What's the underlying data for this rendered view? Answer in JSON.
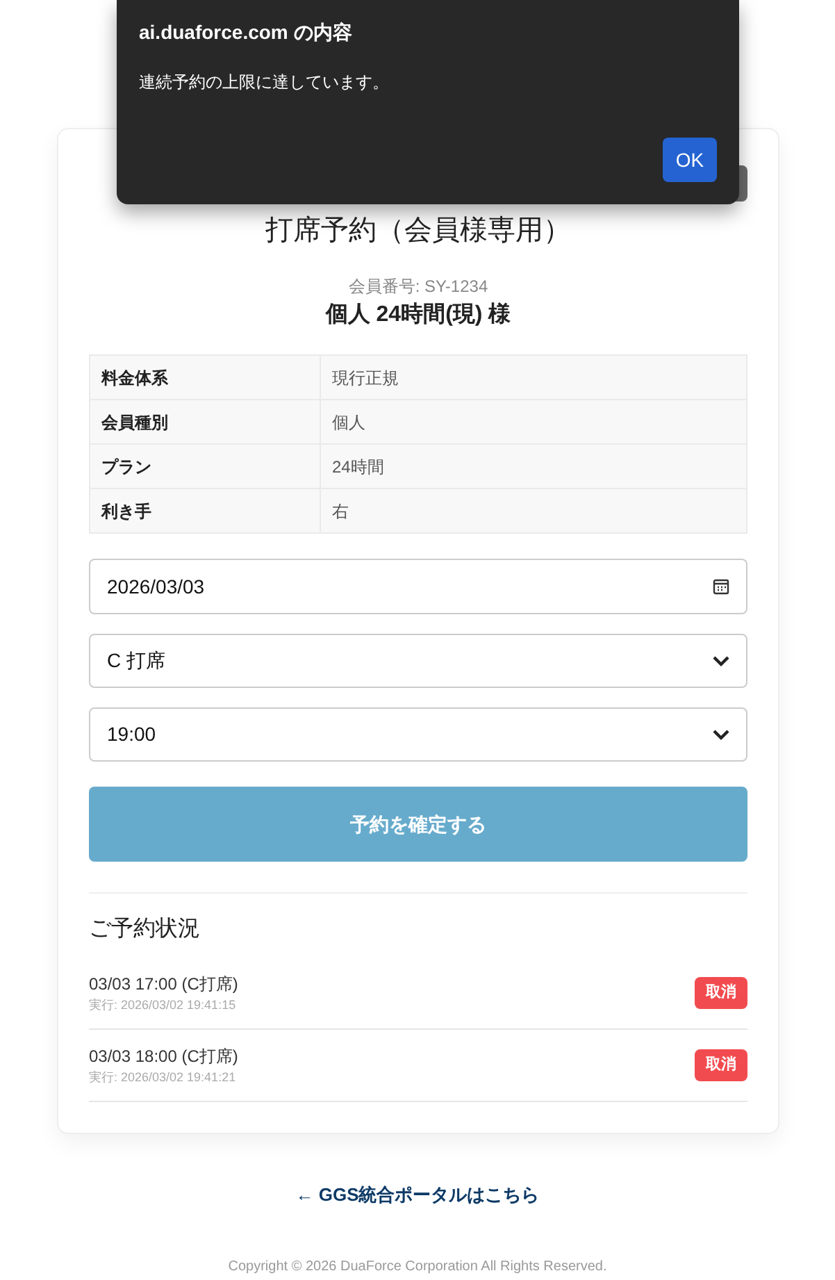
{
  "dialog": {
    "title": "ai.duaforce.com の内容",
    "message": "連続予約の上限に達しています。",
    "ok_button": "OK"
  },
  "page": {
    "title": "打席予約（会員様専用）",
    "member_number": "会員番号: SY-1234",
    "member_name": "個人 24時間(現) 様"
  },
  "member_info": [
    {
      "label": "料金体系",
      "value": "現行正規"
    },
    {
      "label": "会員種別",
      "value": "個人"
    },
    {
      "label": "プラン",
      "value": "24時間"
    },
    {
      "label": "利き手",
      "value": "右"
    }
  ],
  "form": {
    "date": "2026/03/03",
    "bay": "C 打席",
    "time": "19:00",
    "submit_button": "予約を確定する"
  },
  "reservations": {
    "title": "ご予約状況",
    "items": [
      {
        "slot": "03/03 17:00 (C打席)",
        "executed": "実行: 2026/03/02 19:41:15",
        "cancel_button": "取消"
      },
      {
        "slot": "03/03 18:00 (C打席)",
        "executed": "実行: 2026/03/02 19:41:21",
        "cancel_button": "取消"
      }
    ]
  },
  "portal_link": "← GGS統合ポータルはこちら",
  "copyright": "Copyright © 2026 DuaForce Corporation All Rights Reserved."
}
